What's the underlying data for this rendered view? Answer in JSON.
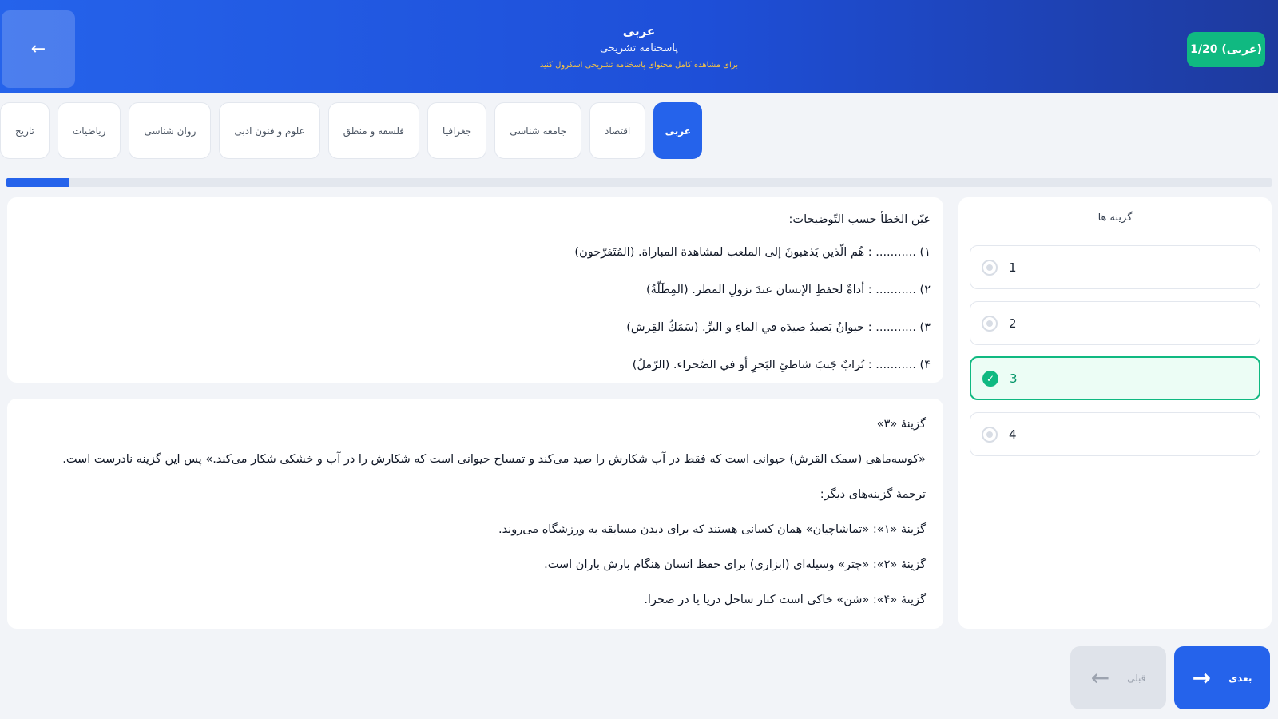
{
  "header": {
    "back_icon": "arrow-left-icon",
    "title": "عربی",
    "subtitle": "پاسخنامه تشریحی",
    "hint": "برای مشاهده کامل محتوای پاسخنامه تشریحی اسکرول کنید",
    "counter": "1/20 (عربی)"
  },
  "tabs": [
    {
      "label": "عربی",
      "active": true
    },
    {
      "label": "اقتصاد",
      "active": false
    },
    {
      "label": "جامعه شناسی",
      "active": false
    },
    {
      "label": "جغرافیا",
      "active": false
    },
    {
      "label": "فلسفه و منطق",
      "active": false
    },
    {
      "label": "علوم و فنون ادبی",
      "active": false
    },
    {
      "label": "روان شناسی",
      "active": false
    },
    {
      "label": "ریاضیات",
      "active": false
    },
    {
      "label": "تاریخ",
      "active": false
    }
  ],
  "progress": {
    "fraction": 0.05
  },
  "question": {
    "prompt": "عيّن الخطأ حسب التّوضيحات:",
    "lines": [
      "۱) ........... : هُم الّذين يَذهبونَ إلى الملعب لمشاهدة المباراة. (المُتَفرّجون)",
      "۲) ........... : أداةٌ لحفظِ الإنسان عندَ نزولِ المطر. (المِظَلّةُ)",
      "۳) ........... : حيوانٌ يَصيدُ صيدَه في الماءِ و البرِّ. (سَمَكُ القِرش)",
      "۴) ........... : تُرابٌ جَنبَ شاطئِ البَحرِ أو في الصَّحراء. (الرّملُ)"
    ]
  },
  "answer": {
    "lines": [
      "گزینۀ «۳»",
      "«کوسه‌ماهی (سمک القرش) حیوانی است که فقط در آب شکارش را صید می‌کند و تمساح حیوانی است که شکارش را در آب و خشکی شکار می‌کند.» پس این گزینه نادرست است.",
      "ترجمۀ گزینه‌های دیگر:",
      "گزینۀ «۱»: «تماشاچیان» همان کسانی هستند که برای دیدن مسابقه به ورزشگاه می‌روند.",
      "گزینۀ «۲»: «چتر» وسیله‌ای (ابزاری) برای حفظ انسان هنگام بارش باران است.",
      "گزینۀ «۴»: «شن» خاکی است کنار ساحل دریا یا در صحرا."
    ]
  },
  "options": {
    "title": "گزینه ها",
    "items": [
      {
        "label": "1",
        "selected": false
      },
      {
        "label": "2",
        "selected": false
      },
      {
        "label": "3",
        "selected": true
      },
      {
        "label": "4",
        "selected": false
      }
    ]
  },
  "nav": {
    "prev_label": "قبلی",
    "next_label": "بعدی",
    "prev_icon": "arrow-left-icon",
    "next_icon": "arrow-right-icon"
  },
  "colors": {
    "primary": "#2563eb",
    "success": "#10b981",
    "hint": "#f6c445"
  }
}
